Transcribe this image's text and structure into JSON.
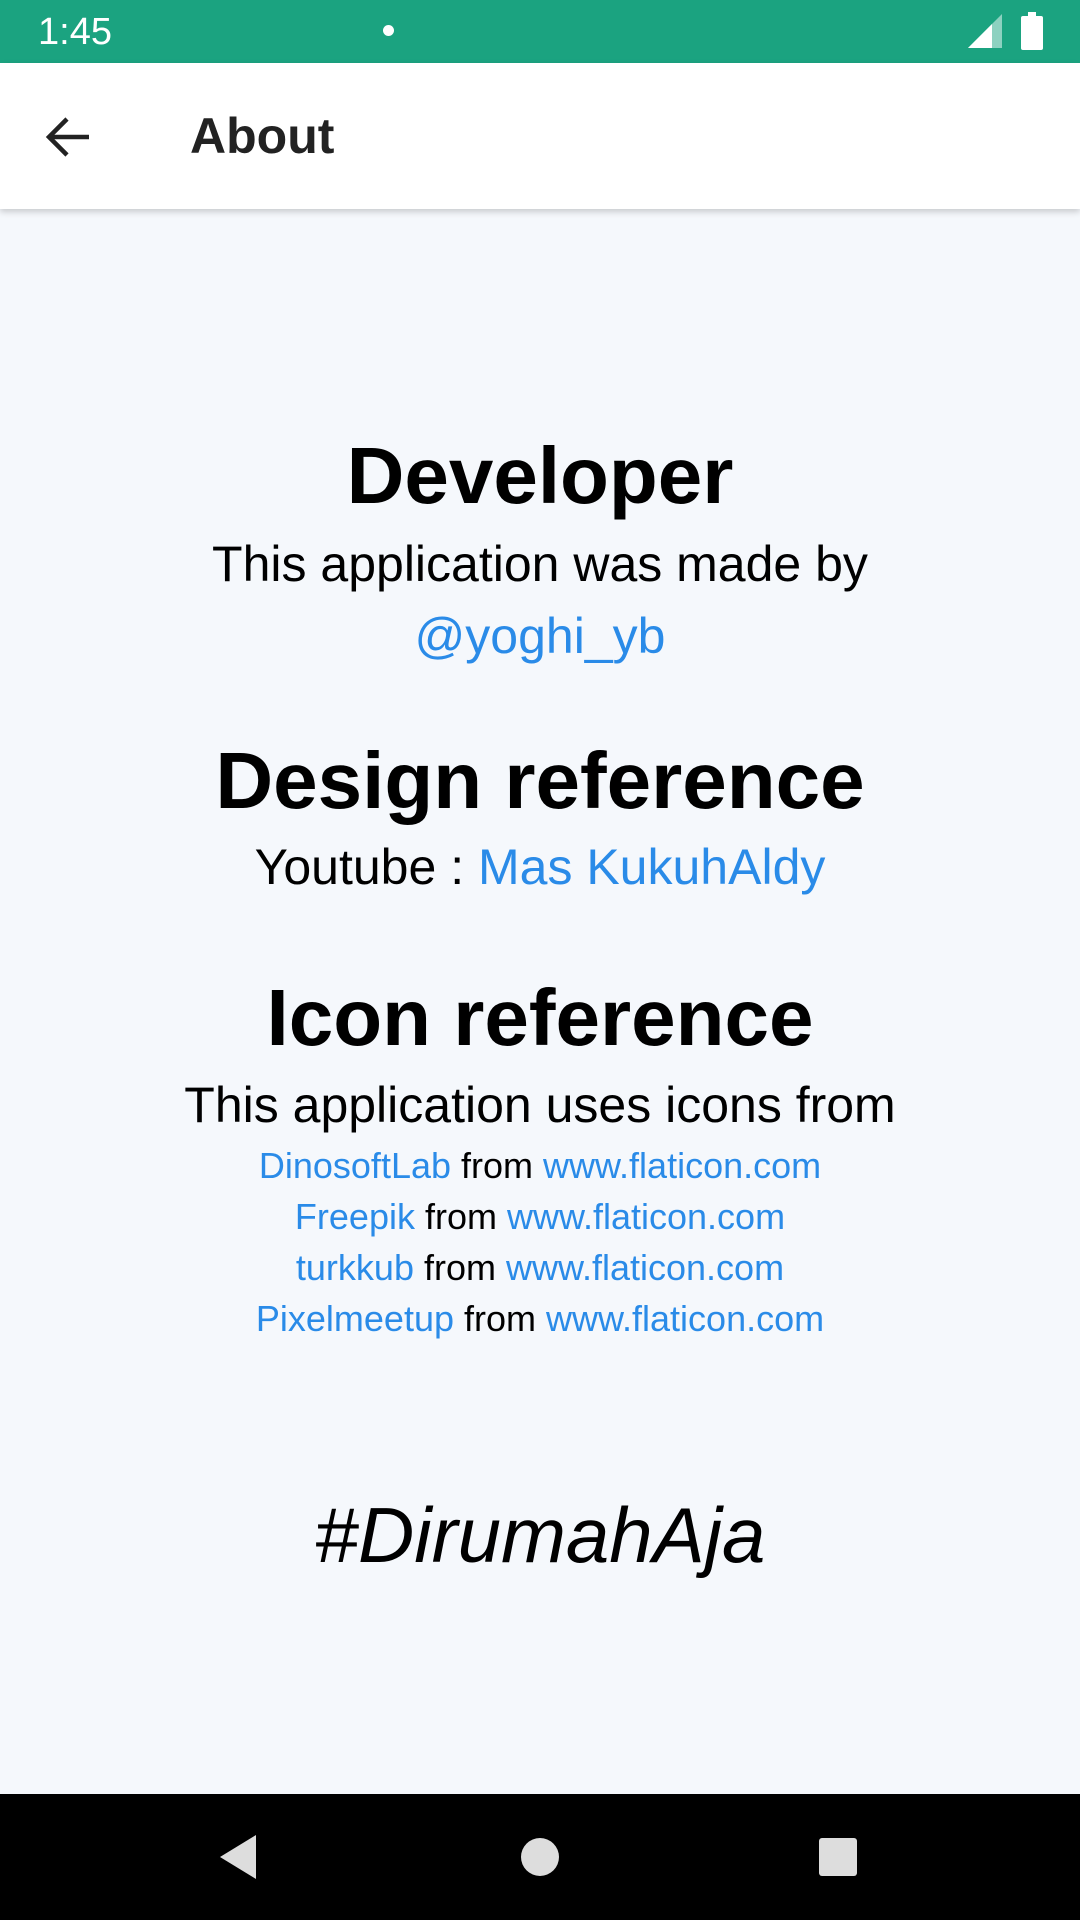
{
  "status_bar": {
    "time": "1:45",
    "color": "#1ba380",
    "icons": [
      "notification-dot-icon",
      "signal-icon",
      "battery-icon"
    ]
  },
  "app_bar": {
    "title": "About",
    "back_icon": "arrow-left-icon"
  },
  "developer": {
    "heading": "Developer",
    "text": "This application was made by",
    "link": "@yoghi_yb"
  },
  "design_reference": {
    "heading": "Design reference",
    "prefix": "Youtube : ",
    "link": "Mas KukuhAldy"
  },
  "icon_reference": {
    "heading": "Icon reference",
    "text": "This application uses icons from",
    "credits": [
      {
        "author": "DinosoftLab",
        "from": " from ",
        "site": "www.flaticon.com"
      },
      {
        "author": "Freepik",
        "from": " from ",
        "site": "www.flaticon.com"
      },
      {
        "author": "turkkub",
        "from": " from ",
        "site": "www.flaticon.com"
      },
      {
        "author": "Pixelmeetup",
        "from": " from ",
        "site": "www.flaticon.com"
      }
    ]
  },
  "hashtag": "#DirumahAja",
  "colors": {
    "accent": "#2a8be8",
    "background": "#f5f8fc",
    "status_bar": "#1ba380"
  },
  "nav_bar": {
    "icons": [
      "nav-back-icon",
      "nav-home-icon",
      "nav-recents-icon"
    ]
  }
}
